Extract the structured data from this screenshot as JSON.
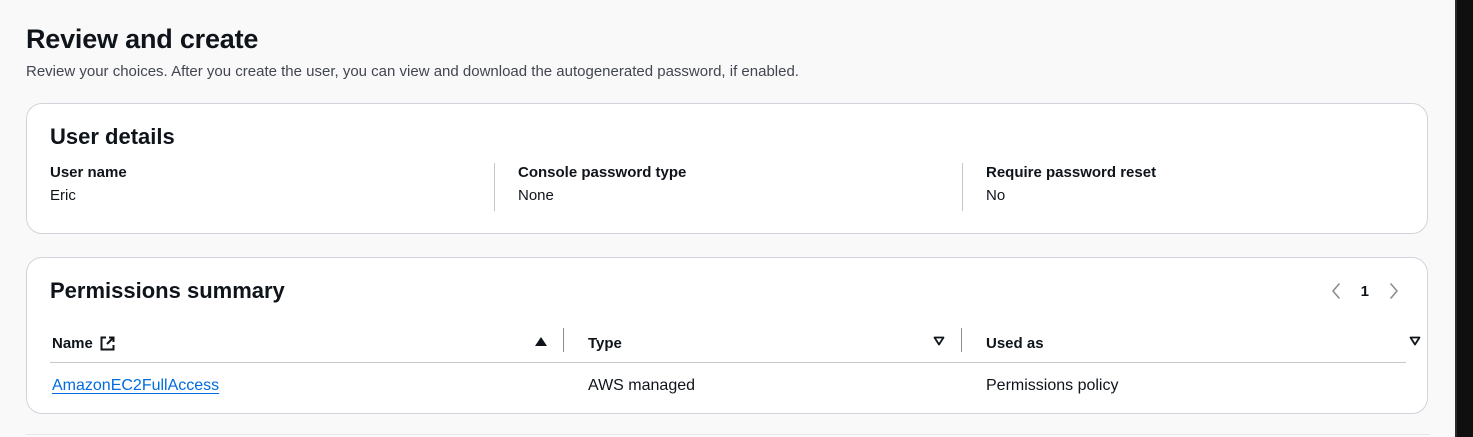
{
  "page": {
    "title": "Review and create",
    "subtitle": "Review your choices. After you create the user, you can view and download the autogenerated password, if enabled."
  },
  "user_details": {
    "title": "User details",
    "fields": [
      {
        "label": "User name",
        "value": "Eric"
      },
      {
        "label": "Console password type",
        "value": "None"
      },
      {
        "label": "Require password reset",
        "value": "No"
      }
    ]
  },
  "permissions": {
    "title": "Permissions summary",
    "pagination": {
      "current_page": "1",
      "prev_icon": "chevron-left-icon",
      "next_icon": "chevron-right-icon"
    },
    "columns": [
      {
        "label": "Name",
        "icon": "external-link-icon",
        "sort": "ascending"
      },
      {
        "label": "Type",
        "sort": "none"
      },
      {
        "label": "Used as",
        "sort": "none"
      }
    ],
    "rows": [
      {
        "name": "AmazonEC2FullAccess",
        "type": "AWS managed",
        "used_as": "Permissions policy"
      }
    ]
  },
  "colors": {
    "link": "#006ce0",
    "text": "#0f141a",
    "border": "#d1d5db",
    "background": "#f9f9fa"
  }
}
